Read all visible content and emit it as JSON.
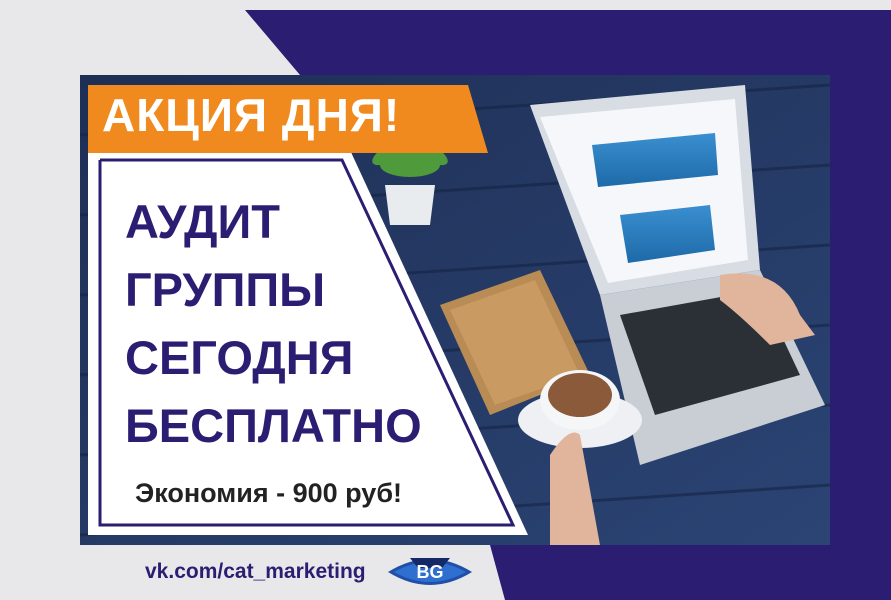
{
  "banner": {
    "label": "АКЦИЯ ДНЯ!"
  },
  "headline": {
    "lines": [
      "АУДИТ",
      "ГРУППЫ",
      "СЕГОДНЯ",
      "БЕСПЛАТНО"
    ]
  },
  "savings": {
    "text": "Экономия - 900 руб!"
  },
  "footer": {
    "link": "vk.com/cat_marketing",
    "logo_text": "BG"
  },
  "colors": {
    "brand_purple": "#2b1d72",
    "accent_orange": "#f08a1e",
    "panel_white": "#ffffff"
  },
  "photo": {
    "description_icon": "laptop-coffee-photo"
  }
}
